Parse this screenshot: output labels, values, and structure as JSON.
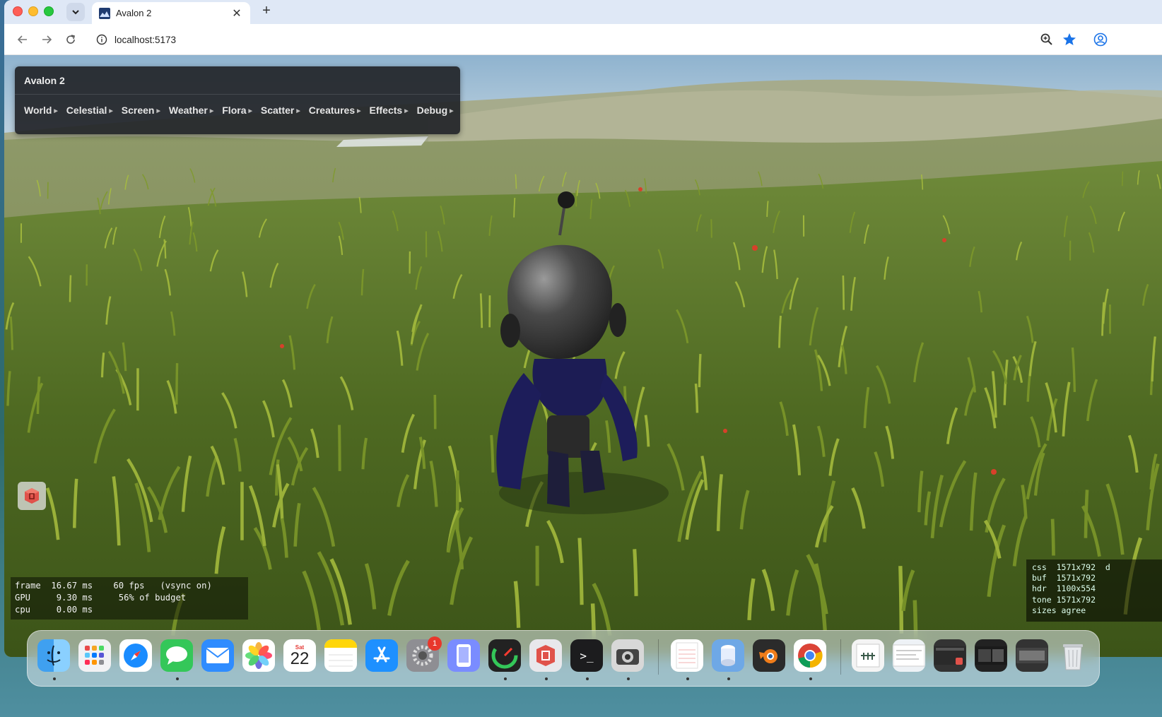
{
  "browser": {
    "tab_title": "Avalon 2",
    "url": "localhost:5173"
  },
  "app": {
    "panel_title": "Avalon 2",
    "menu": [
      "World",
      "Celestial",
      "Screen",
      "Weather",
      "Flora",
      "Scatter",
      "Creatures",
      "Effects",
      "Debug"
    ]
  },
  "stats": {
    "line1": "frame  16.67 ms    60 fps   (vsync on)",
    "line2": "GPU     9.30 ms     56% of budget",
    "line3": "cpu     0.00 ms"
  },
  "sizes": {
    "line1": "css  1571x792  d",
    "line2": "buf  1571x792",
    "line3": "hdr  1100x554",
    "line4": "tone 1571x792",
    "line5": "sizes agree"
  },
  "dock": {
    "calendar_day": "Sat",
    "calendar_date": "22",
    "settings_badge": "1",
    "terminal_glyph": ">_"
  },
  "colors": {
    "accent_star": "#1a73e8",
    "panel_bg": "#222428"
  }
}
